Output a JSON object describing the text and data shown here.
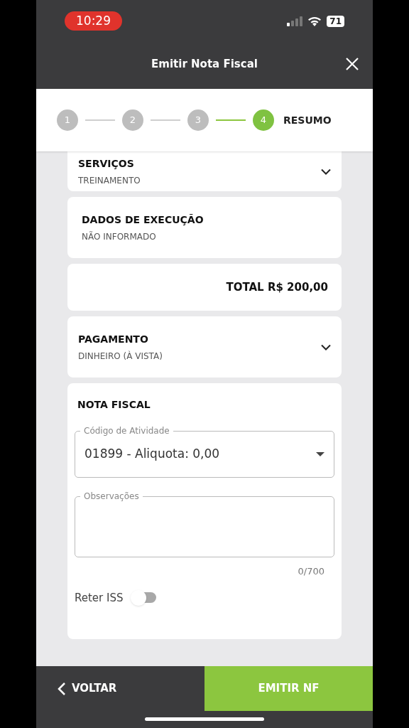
{
  "status_bar": {
    "time": "10:29",
    "battery": "71"
  },
  "header": {
    "title": "Emitir Nota Fiscal"
  },
  "stepper": {
    "steps": [
      {
        "label": "1",
        "selected": false
      },
      {
        "label": "2",
        "selected": false
      },
      {
        "label": "3",
        "selected": false
      },
      {
        "label": "4",
        "selected": true
      }
    ],
    "current_title": "RESUMO"
  },
  "sections": [
    {
      "kind": "collapsible",
      "title": "SERVIÇOS",
      "value": "TREINAMENTO"
    },
    {
      "kind": "plain",
      "title": "DADOS DE EXECUÇÃO",
      "value": "NÃO INFORMADO"
    },
    {
      "kind": "total",
      "value": "TOTAL R$ 200,00"
    },
    {
      "kind": "collapsible",
      "title": "PAGAMENTO",
      "value": "DINHEIRO (À VISTA)"
    }
  ],
  "nota_fiscal": {
    "title": "NOTA FISCAL",
    "activity_field": {
      "label": "Código de Atividade",
      "value": "01899 - Aliquota: 0,00"
    },
    "notes_field": {
      "label": "Observações",
      "counter": "0/700"
    },
    "reter_iss": {
      "label": "Reter ISS",
      "on": false
    }
  },
  "footer": {
    "back": "VOLTAR",
    "submit": "EMITIR NF"
  }
}
